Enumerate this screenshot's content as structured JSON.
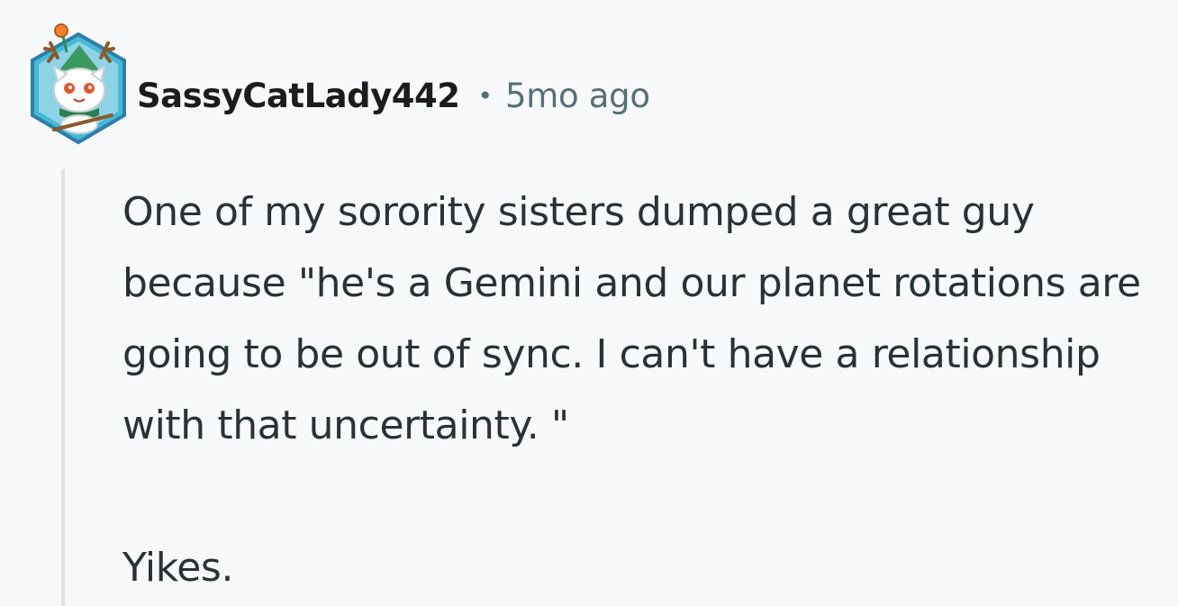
{
  "comment": {
    "author": "SassyCatLady442",
    "separator": "•",
    "time_ago": "5mo ago",
    "avatar_icon": "cat-creature-avatar-icon",
    "paragraphs": [
      "One of my sorority sisters dumped a great guy because \"he's a Gemini and our planet rotations are going to be out of sync. I can't have a relationship with that uncertainty. \"",
      "Yikes."
    ]
  },
  "colors": {
    "background": "#f7f9fa",
    "text": "#1c1c1c",
    "meta": "#576f76",
    "thread_line": "#dfe3e6",
    "avatar_border": "#3fb7c9"
  }
}
